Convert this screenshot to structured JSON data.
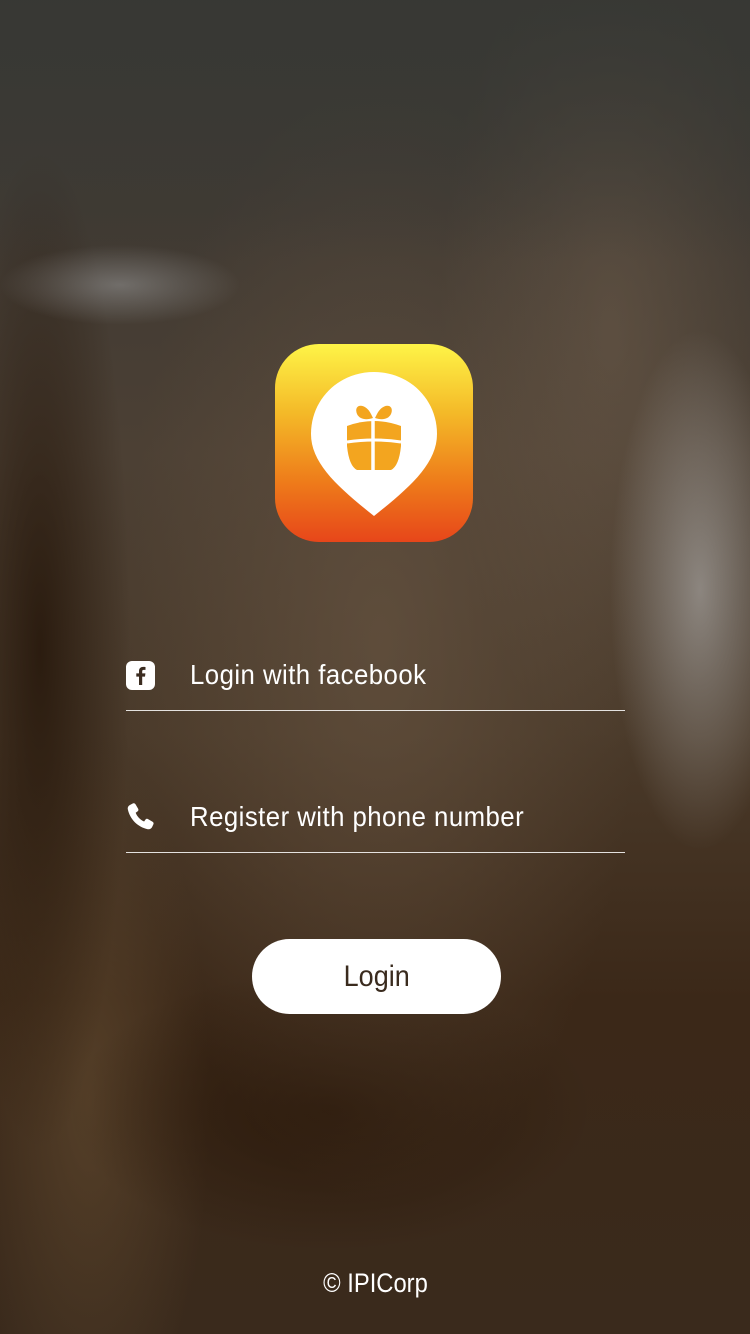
{
  "app": {
    "logo_icon": "gift-location-pin-icon",
    "logo_gradient": [
      "#fef447",
      "#e7461a"
    ]
  },
  "login_options": {
    "facebook": {
      "icon": "facebook-icon",
      "label": "Login with facebook"
    },
    "phone": {
      "icon": "phone-icon",
      "label": "Register with phone number"
    }
  },
  "login_button": {
    "label": "Login"
  },
  "footer": {
    "copyright": "© IPICorp"
  }
}
